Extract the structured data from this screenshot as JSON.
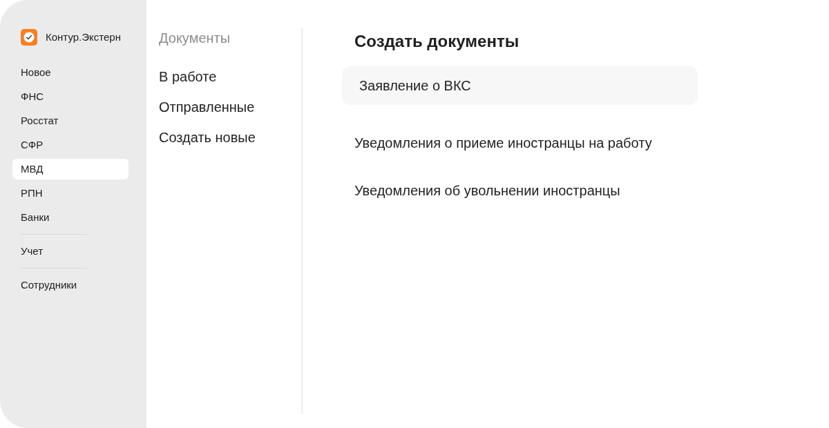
{
  "sidebar": {
    "brand": "Контур.Экстерн",
    "groups": [
      {
        "items": [
          {
            "label": "Новое",
            "selected": false
          },
          {
            "label": "ФНС",
            "selected": false
          },
          {
            "label": "Росстат",
            "selected": false
          },
          {
            "label": "СФР",
            "selected": false
          },
          {
            "label": "МВД",
            "selected": true
          },
          {
            "label": "РПН",
            "selected": false
          },
          {
            "label": "Банки",
            "selected": false
          }
        ]
      },
      {
        "items": [
          {
            "label": "Учет",
            "selected": false
          }
        ]
      },
      {
        "items": [
          {
            "label": "Сотрудники",
            "selected": false
          }
        ]
      }
    ]
  },
  "documents_menu": {
    "title": "Документы",
    "items": [
      {
        "label": "В работе"
      },
      {
        "label": "Отправленные"
      },
      {
        "label": "Создать новые"
      }
    ]
  },
  "create_panel": {
    "title": "Создать документы",
    "items": [
      {
        "label": "Заявление о ВКС",
        "selected": true
      },
      {
        "label": "Уведомления о приеме иностранцы на работу",
        "selected": false
      },
      {
        "label": "Уведомления об увольнении иностранцы",
        "selected": false
      }
    ]
  }
}
